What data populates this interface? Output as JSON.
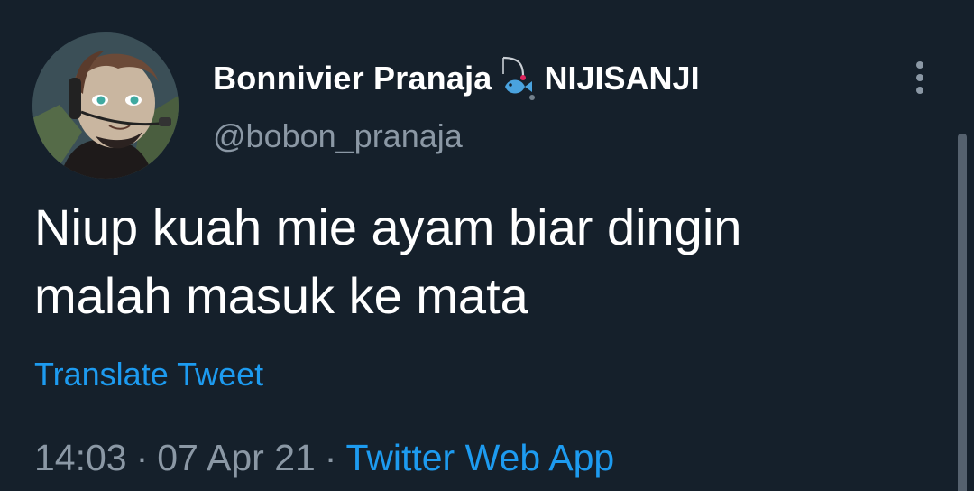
{
  "tweet": {
    "author": {
      "display_name": "Bonnivier Pranaja",
      "badge_icon": "fishing-fish-icon",
      "org_label": "NIJISANJI",
      "handle": "@bobon_pranaja",
      "avatar_icon": "avatar-image"
    },
    "text_lines": [
      "Niup kuah mie ayam biar dingin",
      "malah masuk ke mata"
    ],
    "translate_label": "Translate Tweet",
    "time": "14:03",
    "separator": "·",
    "date": "07 Apr 21",
    "source": "Twitter Web App",
    "more_icon": "more-vertical-icon"
  },
  "colors": {
    "background": "#15202b",
    "primary_text": "#ffffff",
    "secondary_text": "#8b98a5",
    "accent": "#1d9bf0"
  }
}
